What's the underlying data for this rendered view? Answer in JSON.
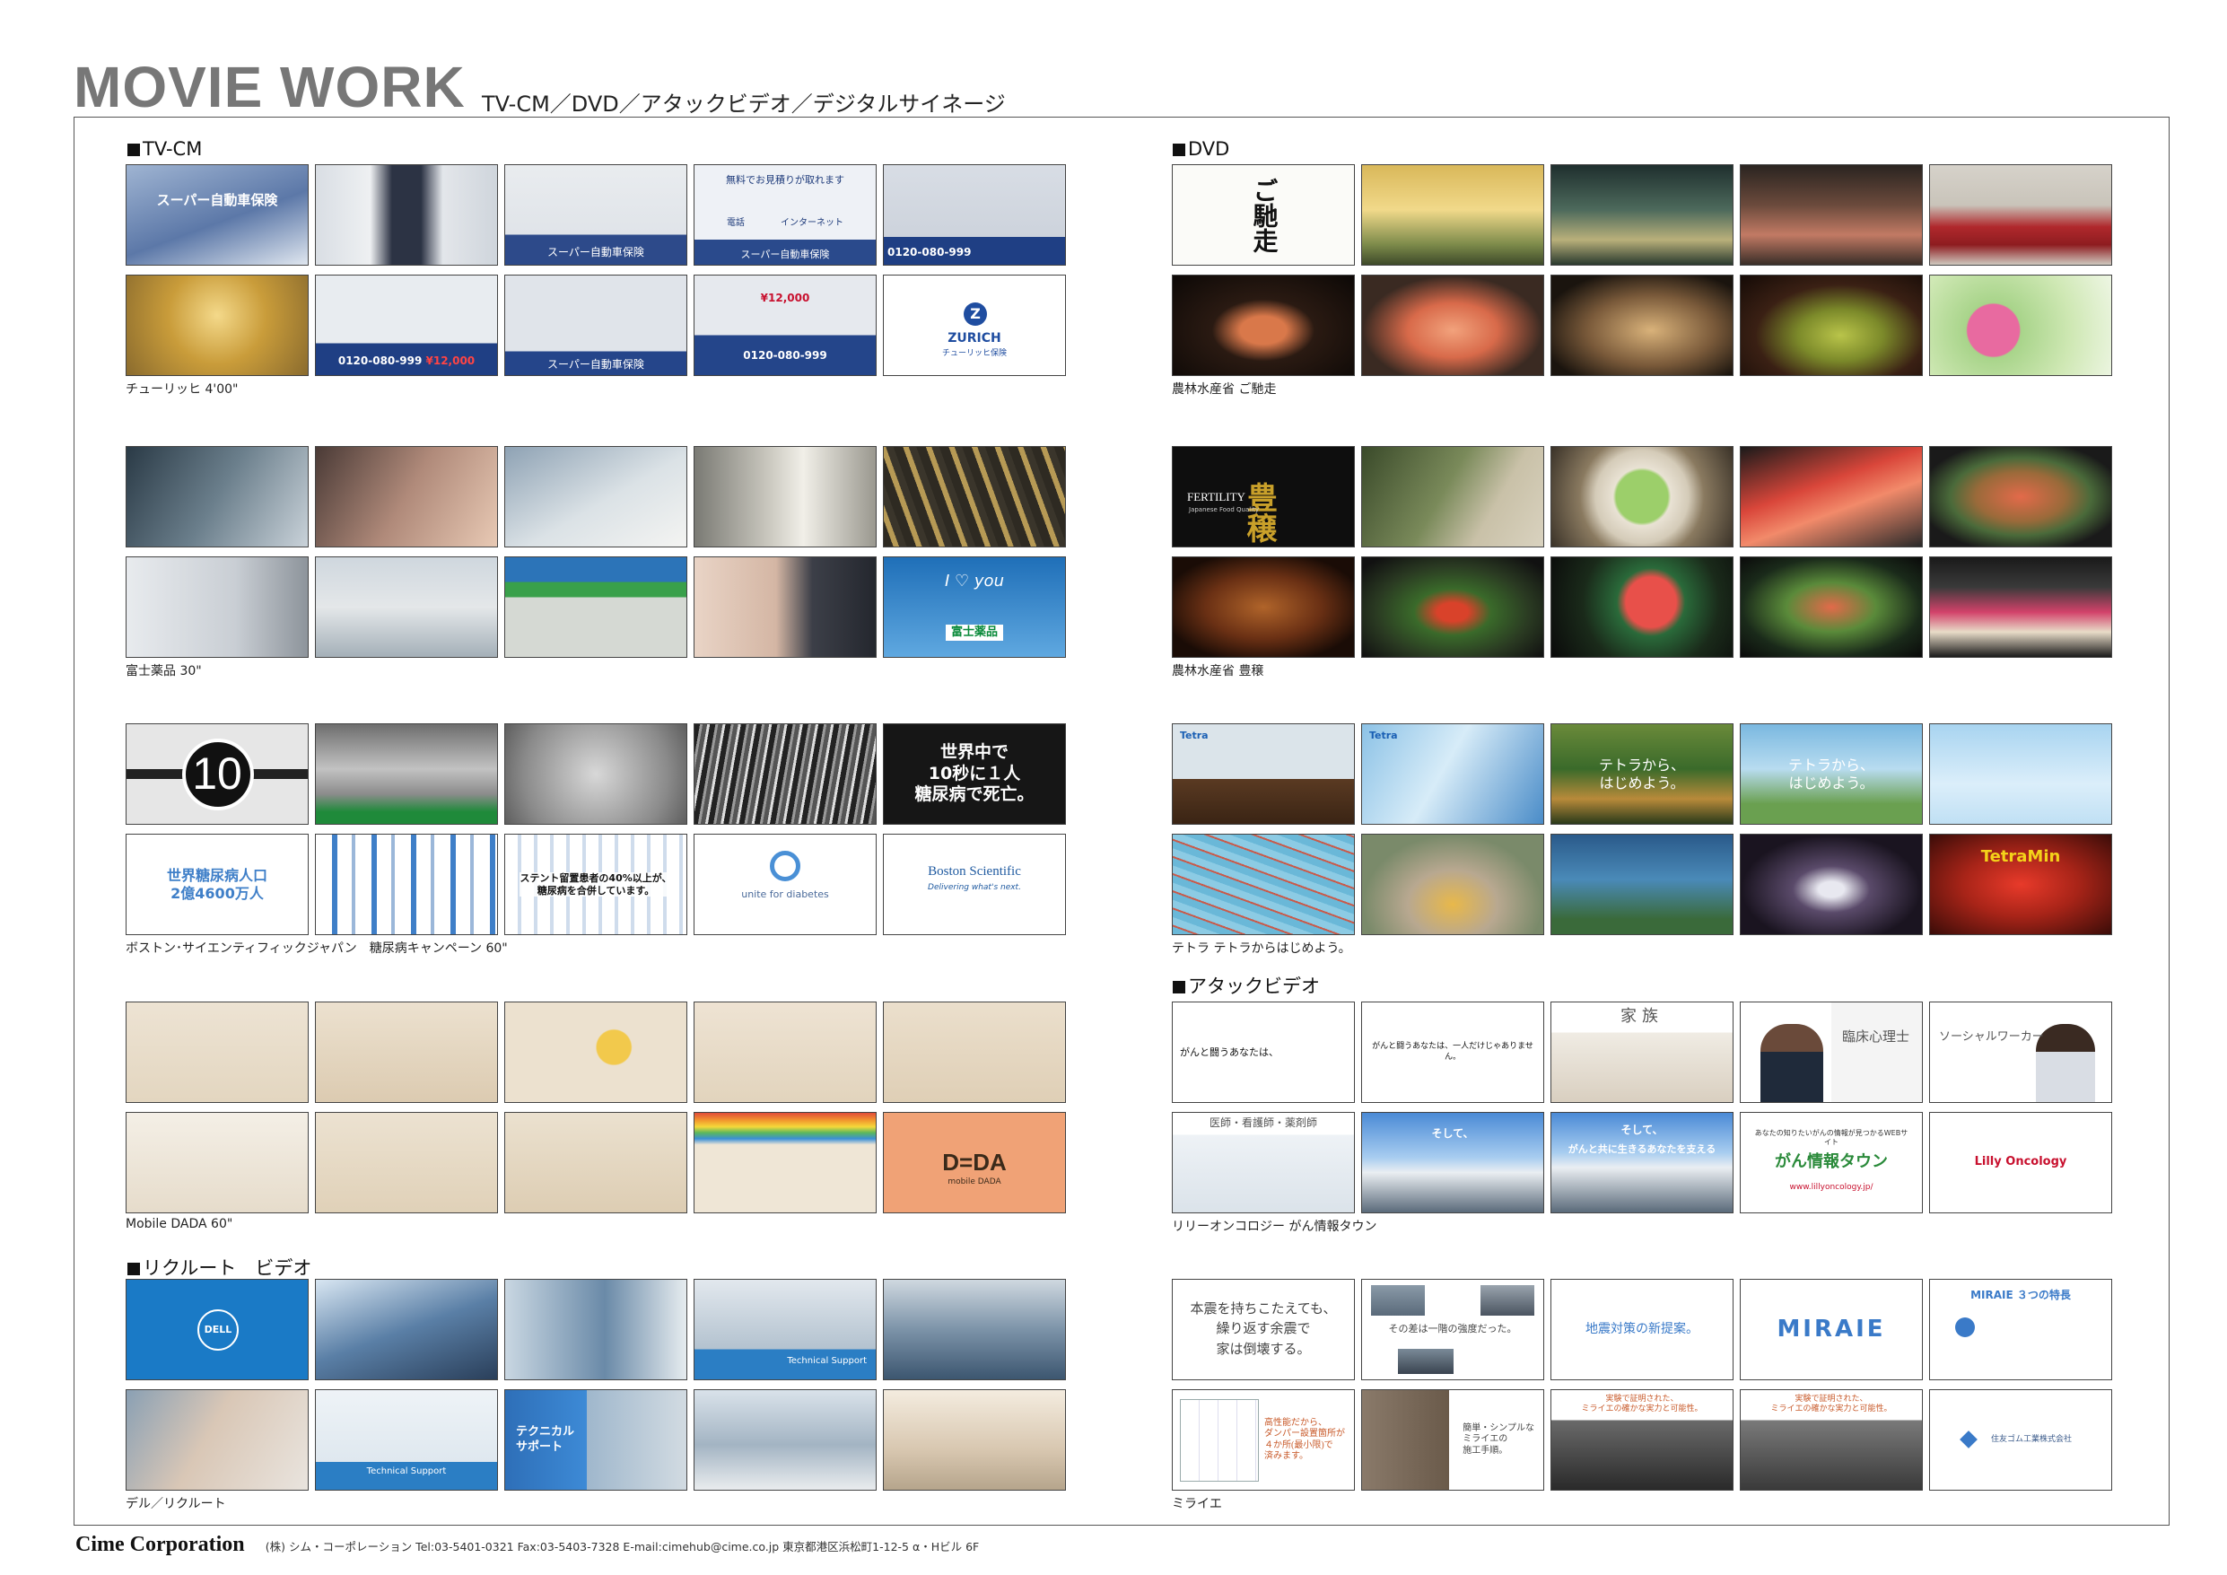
{
  "header": {
    "title": "MOVIE WORK",
    "subtitle": "TV-CM／DVD／アタックビデオ／デジタルサイネージ"
  },
  "sections": {
    "tvcm": "TV-CM",
    "dvd": "DVD",
    "attack": "アタックビデオ",
    "recruit": "リクルート　ビデオ"
  },
  "captions": {
    "zurich": "チューリッヒ 4'00\"",
    "fuji": "富士薬品 30\"",
    "boston": "ボストン･サイエンティフィックジャパン　糖尿病キャンペーン 60\"",
    "dada": "Mobile DADA 60\"",
    "dell": "デル／リクルート",
    "gochiso": "農林水産省 ご馳走",
    "houjo": "農林水産省 豊穣",
    "tetra": "テトラ テトラからはじめよう。",
    "lilly": "リリーオンコロジー がん情報タウン",
    "miraie": "ミライエ"
  },
  "thumb_text": {
    "z_phone": "0120-080-999",
    "z_price": "¥12,000",
    "z_logo": "ZURICH",
    "z_logo_sub": "チューリッヒ保険",
    "z_estimate": "無料でお見積りが取れます",
    "z_tel": "電話",
    "z_net": "インターネット",
    "z_band": "スーパー自動車保険",
    "f_brand": "富士薬品",
    "f_you": "I ♡ you",
    "b_ten": "10",
    "b_world": "世界中で\n10秒に１人\n糖尿病で死亡。",
    "b_pop": "世界糖尿病人口\n2億4600万人",
    "b_stent": "ステント留置患者の40%以上が、\n糖尿病を合併しています。",
    "b_unite": "unite for diabetes",
    "b_boston": "Boston Scientific",
    "b_boston_sub": "Delivering what's next.",
    "d_dada": "D=DA",
    "d_dada_sub": "mobile DADA",
    "r_dell": "DELL",
    "r_tech": "Technical Support",
    "r_tech_jp": "テクニカル\nサポート",
    "g_title": "ご馳走",
    "h_title": "豊穣",
    "h_fert": "FERTILITY",
    "h_fert_sub": "Japanese Food Quality",
    "t_tetra": "Tetra",
    "t_start": "テトラから、\nはじめよう。",
    "t_tetramin": "TetraMin",
    "a_1": "がんと闘うあなたは、",
    "a_2": "がんと闘うあなたは、一人だけじゃありません。",
    "a_family": "家族",
    "a_psych": "臨床心理士",
    "a_social": "ソーシャルワーカー",
    "a_doctor": "医師・看護師・薬剤師",
    "a_soshite": "そして、",
    "a_tomo": "がんと共に生きるあなたを支える",
    "a_web": "あなたの知りたいがんの情報が見つかるWEBサイト",
    "a_town": "がん情報タウン",
    "a_url": "www.lillyoncology.jp/",
    "a_lilly": "Lilly Oncology",
    "m_1": "本震を持ちこたえても、\n繰り返す余震で\n家は倒壊する。",
    "m_2": "その差は一階の強度だった。",
    "m_3": "地震対策の新提案。",
    "m_4": "MIRAIE",
    "m_5": "MIRAIE ３つの特長",
    "m_6": "高性能だから、\nダンパー設置箇所が\n４か所(最小限)で\n済みます。",
    "m_7": "簡単・シンプルな\nミライエの\n施工手順。",
    "m_8": "実験で証明された、\nミライエの確かな実力と可能性。",
    "m_9": "実験で証明された、\nミライエの確かな実力と可能性。",
    "m_10": "住友ゴム工業株式会社"
  },
  "footer": {
    "company": "Cime Corporation",
    "info": "(株) シム・コーポレーション  Tel:03-5401-0321  Fax:03-5403-7328  E-mail:cimehub@cime.co.jp  東京都港区浜松町1-12-5 α・Hビル 6F"
  }
}
